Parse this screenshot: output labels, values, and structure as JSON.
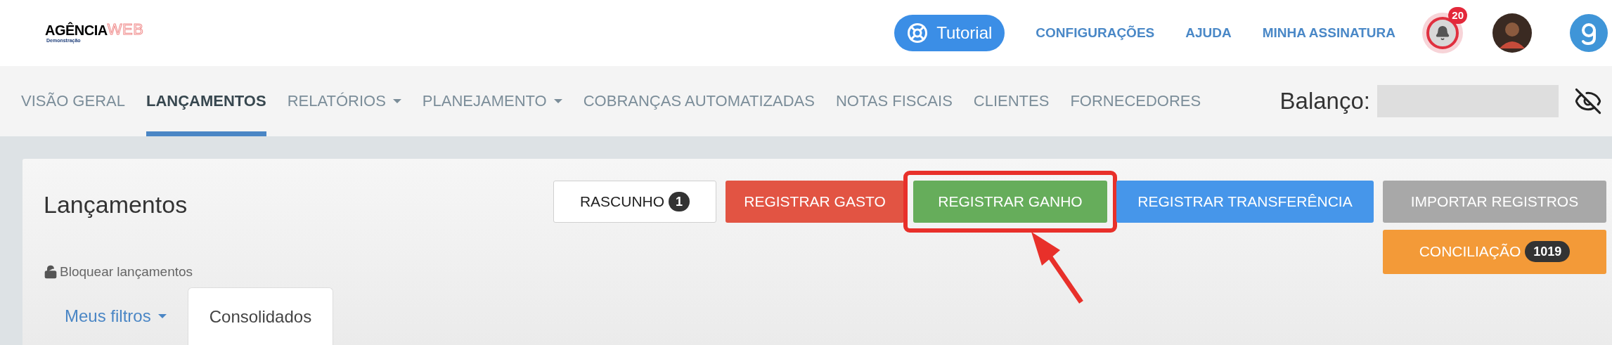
{
  "logo": {
    "name": "AGÊNCIA",
    "accent": "WEB",
    "subtitle": "Demonstração"
  },
  "header": {
    "tutorial": "Tutorial",
    "links": [
      "CONFIGURAÇÕES",
      "AJUDA",
      "MINHA ASSINATURA"
    ],
    "notifications": "20"
  },
  "nav": [
    {
      "label": "VISÃO GERAL",
      "selected": false,
      "dropdown": false
    },
    {
      "label": "LANÇAMENTOS",
      "selected": true,
      "dropdown": false
    },
    {
      "label": "RELATÓRIOS",
      "selected": false,
      "dropdown": true
    },
    {
      "label": "PLANEJAMENTO",
      "selected": false,
      "dropdown": true
    },
    {
      "label": "COBRANÇAS AUTOMATIZADAS",
      "selected": false,
      "dropdown": false
    },
    {
      "label": "NOTAS FISCAIS",
      "selected": false,
      "dropdown": false
    },
    {
      "label": "CLIENTES",
      "selected": false,
      "dropdown": false
    },
    {
      "label": "FORNECEDORES",
      "selected": false,
      "dropdown": false
    }
  ],
  "balance": {
    "label": "Balanço:",
    "hidden": true
  },
  "page": {
    "title": "Lançamentos",
    "lock": "Bloquear lançamentos"
  },
  "actions": [
    {
      "kind": "draft",
      "label": "RASCUNHO",
      "count": "1",
      "highlighted": false
    },
    {
      "kind": "expense",
      "label": "REGISTRAR GASTO",
      "highlighted": false
    },
    {
      "kind": "income",
      "label": "REGISTRAR GANHO",
      "highlighted": true
    },
    {
      "kind": "transfer",
      "label": "REGISTRAR TRANSFERÊNCIA",
      "highlighted": false
    },
    {
      "kind": "import",
      "label": "IMPORTAR REGISTROS",
      "highlighted": false
    }
  ],
  "reconcile": {
    "label": "CONCILIAÇÃO",
    "count": "1019"
  },
  "tabs": [
    {
      "label": "Meus filtros",
      "selected": false,
      "dropdown": true
    },
    {
      "label": "Consolidados",
      "selected": true,
      "dropdown": false
    }
  ]
}
